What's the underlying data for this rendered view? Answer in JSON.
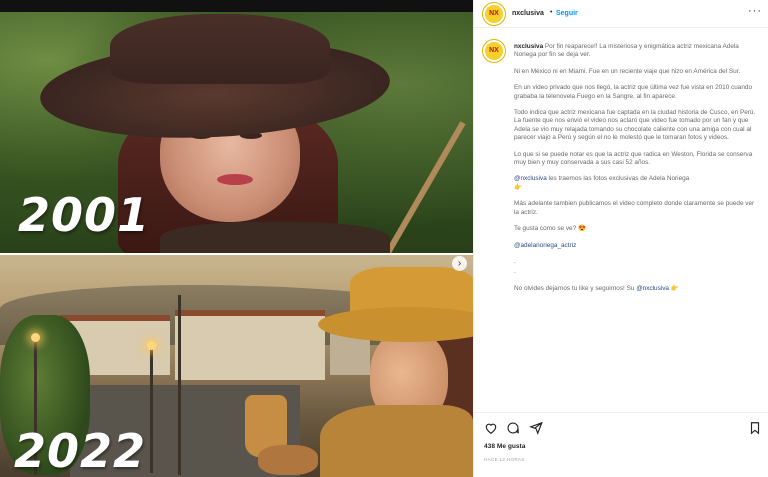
{
  "post": {
    "year_top": "2001",
    "year_bottom": "2022"
  },
  "header": {
    "avatar_text": "NX",
    "username": "nxclusiva",
    "separator": "•",
    "follow_label": "Seguir",
    "more_icon": "more-horizontal-icon"
  },
  "caption": {
    "username": "nxclusiva",
    "p1": "Por fin reaparece!! La misteriosa y enigmática actriz mexicana Adela Noriega por fin se deja ver.",
    "p2": "Ni en México ni en Miami. Fue en un reciente viaje que hizo en América del Sur.",
    "p3": "En un video privado que nos llegó, la actriz que última vez fue vista en 2010 cuando grababa la telenovela Fuego en la Sangre, al fin aparece.",
    "p4": "Todo indica que actriz mexicana fue captada en la ciudad historia de Cusco, en Perú. La fuente que nos envió el video nos aclaró que video fue tomado por un fan y que Adela se vio muy relajada tomando su chocolate caliente con una amiga con cual al parecer viajo a Perú y según el no le molestó que le tomaran fotos y videos.",
    "p5": "Lo que si se puede notar es que la actriz que radica en Weston, Florida se conserva muy bien y muy conservada a sus casi 52 años.",
    "p6_mention": "@nxclusiva",
    "p6_text": "les traemos las fotos exclusivas de Adela Noriega",
    "p6_emoji": "👉",
    "p7": "Más adelante tambien publicamos el video completo donde claramente se puede ver la actriz.",
    "p8": "Te gusta como se ve?",
    "p8_emoji": "😍",
    "p9_mention": "@adelanoriega_actriz",
    "p10a": ".",
    "p10b": ".",
    "p11_text": "No olvides dejarnos tu like y seguirnos! Su",
    "p11_mention": "@nxclusiva",
    "p11_emoji": "👉"
  },
  "actions": {
    "like_icon": "heart-icon",
    "comment_icon": "comment-icon",
    "share_icon": "send-icon",
    "save_icon": "bookmark-icon"
  },
  "stats": {
    "likes": "438 Me gusta",
    "timestamp": "HACE 12 HORAS"
  },
  "colors": {
    "follow_blue": "#0095f6",
    "avatar_yellow": "#f5d02a",
    "text_dark": "#262626"
  }
}
